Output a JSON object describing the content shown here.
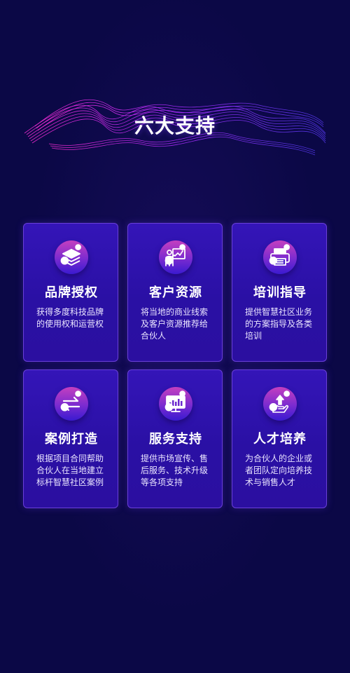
{
  "section": {
    "title": "六大支持"
  },
  "cards": [
    {
      "icon": "layers-icon",
      "title": "品牌授权",
      "desc": "获得多度科技品牌的使用权和运营权"
    },
    {
      "icon": "presenter-chart-icon",
      "title": "客户资源",
      "desc": "将当地的商业线索及客户资源推荐给合伙人"
    },
    {
      "icon": "printer-icon",
      "title": "培训指导",
      "desc": "提供智慧社区业务的方案指导及各类培训"
    },
    {
      "icon": "swap-arrows-icon",
      "title": "案例打造",
      "desc": "根据项目合同帮助合伙人在当地建立标杆智慧社区案例"
    },
    {
      "icon": "monitor-chart-icon",
      "title": "服务支持",
      "desc": "提供市场宣传、售后服务、技术升级等各项支持"
    },
    {
      "icon": "growth-hand-icon",
      "title": "人才培养",
      "desc": "为合伙人的企业或者团队定向培养技术与销售人才"
    }
  ],
  "colors": {
    "background": "#0b0846",
    "card": "#3415b8",
    "card_border": "#6a3fd9",
    "icon_gradient_top": "#c43fbf",
    "icon_gradient_bottom": "#3a1ad0"
  }
}
